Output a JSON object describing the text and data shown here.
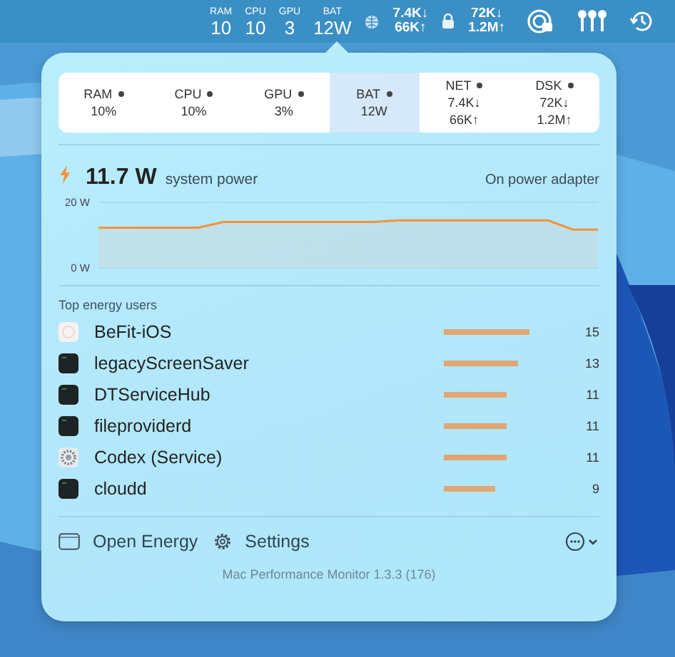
{
  "menu_bar": {
    "metrics": [
      {
        "label": "RAM",
        "value": "10"
      },
      {
        "label": "CPU",
        "value": "10"
      },
      {
        "label": "GPU",
        "value": "3"
      },
      {
        "label": "BAT",
        "value": "12W"
      }
    ],
    "network": {
      "down": "7.4K↓",
      "up": "66K↑"
    },
    "disk": {
      "down": "72K↓",
      "up": "1.2M↑"
    }
  },
  "stats_tabs": [
    {
      "label": "RAM",
      "value_lines": [
        "10%"
      ],
      "selected": false
    },
    {
      "label": "CPU",
      "value_lines": [
        "10%"
      ],
      "selected": false
    },
    {
      "label": "GPU",
      "value_lines": [
        "3%"
      ],
      "selected": false
    },
    {
      "label": "BAT",
      "value_lines": [
        "12W"
      ],
      "selected": true
    },
    {
      "label": "NET",
      "value_lines": [
        "7.4K↓",
        "66K↑"
      ],
      "selected": false
    },
    {
      "label": "DSK",
      "value_lines": [
        "72K↓",
        "1.2M↑"
      ],
      "selected": false
    }
  ],
  "power": {
    "value": "11.7 W",
    "label": "system power",
    "source": "On power adapter",
    "chart_data": {
      "type": "line",
      "yticks": [
        {
          "value": 0,
          "label": "0 W"
        },
        {
          "value": 20,
          "label": "20 W"
        }
      ],
      "ylim": [
        0,
        20
      ],
      "series": [
        {
          "color": "#f5923a",
          "values": [
            12.3,
            12.3,
            12.3,
            12.3,
            12.3,
            14.0,
            14.0,
            14.0,
            14.0,
            14.0,
            14.0,
            14.0,
            14.5,
            14.5,
            14.5,
            14.5,
            14.5,
            14.5,
            14.5,
            11.7,
            11.7
          ]
        }
      ]
    }
  },
  "energy_users": {
    "title": "Top energy users",
    "items": [
      {
        "name": "BeFit-iOS",
        "kind": "app",
        "value": "15"
      },
      {
        "name": "legacyScreenSaver",
        "kind": "terminal",
        "value": "13"
      },
      {
        "name": "DTServiceHub",
        "kind": "terminal",
        "value": "11"
      },
      {
        "name": "fileproviderd",
        "kind": "terminal",
        "value": "11"
      },
      {
        "name": "Codex (Service)",
        "kind": "gear",
        "value": "11"
      },
      {
        "name": "cloudd",
        "kind": "terminal",
        "value": "9"
      }
    ]
  },
  "footer": {
    "open_energy": "Open Energy",
    "settings": "Settings",
    "version": "Mac Performance Monitor 1.3.3 (176)"
  }
}
